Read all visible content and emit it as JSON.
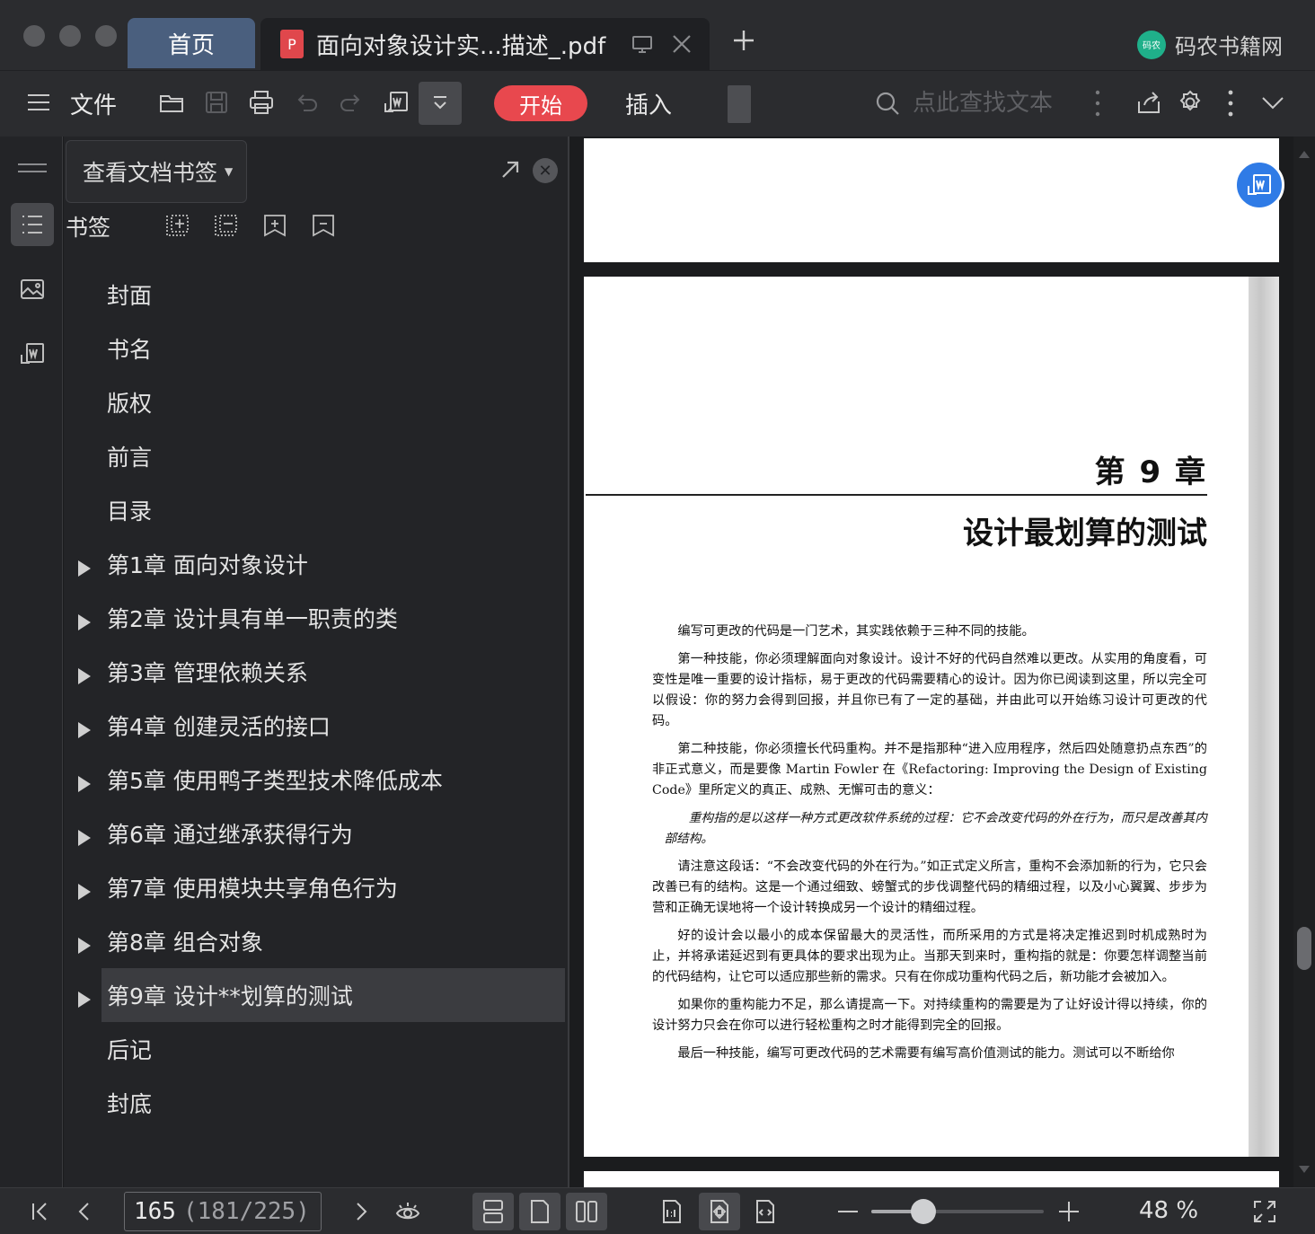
{
  "titlebar": {
    "home_tab": "首页",
    "doc_tab_title": "面向对象设计实...描述_.pdf",
    "pdf_badge": "P",
    "brand": "码农书籍网",
    "brand_logo_text": "码农"
  },
  "toolbar": {
    "file_label": "文件",
    "start_label": "开始",
    "insert_label": "插入",
    "search_placeholder": "点此查找文本"
  },
  "panel": {
    "dropdown_label": "查看文档书签",
    "bookmark_label": "书签",
    "items": [
      {
        "label": "封面",
        "expandable": false
      },
      {
        "label": "书名",
        "expandable": false
      },
      {
        "label": "版权",
        "expandable": false
      },
      {
        "label": "前言",
        "expandable": false
      },
      {
        "label": "目录",
        "expandable": false
      },
      {
        "label": "第1章  面向对象设计",
        "expandable": true
      },
      {
        "label": "第2章  设计具有单一职责的类",
        "expandable": true
      },
      {
        "label": "第3章  管理依赖关系",
        "expandable": true
      },
      {
        "label": "第4章  创建灵活的接口",
        "expandable": true
      },
      {
        "label": "第5章  使用鸭子类型技术降低成本",
        "expandable": true
      },
      {
        "label": "第6章  通过继承获得行为",
        "expandable": true
      },
      {
        "label": "第7章  使用模块共享角色行为",
        "expandable": true
      },
      {
        "label": "第8章  组合对象",
        "expandable": true
      },
      {
        "label": "第9章  设计**划算的测试",
        "expandable": true,
        "selected": true
      },
      {
        "label": "后记",
        "expandable": false
      },
      {
        "label": "封底",
        "expandable": false
      }
    ]
  },
  "document": {
    "chapter_number": "第 9 章",
    "chapter_title": "设计最划算的测试",
    "paragraphs": [
      "编写可更改的代码是一门艺术，其实践依赖于三种不同的技能。",
      "第一种技能，你必须理解面向对象设计。设计不好的代码自然难以更改。从实用的角度看，可变性是唯一重要的设计指标，易于更改的代码需要精心的设计。因为你已阅读到这里，所以完全可以假设：你的努力会得到回报，并且你已有了一定的基础，并由此可以开始练习设计可更改的代码。",
      "第二种技能，你必须擅长代码重构。并不是指那种“进入应用程序，然后四处随意扔点东西”的非正式意义，而是要像 Martin Fowler 在《Refactoring: Improving the Design of Existing Code》里所定义的真正、成熟、无懈可击的意义：",
      "重构指的是以这样一种方式更改软件系统的过程：它不会改变代码的外在行为，而只是改善其内部结构。",
      "请注意这段话：“不会改变代码的外在行为。”如正式定义所言，重构不会添加新的行为，它只会改善已有的结构。这是一个通过细致、螃蟹式的步伐调整代码的精细过程，以及小心翼翼、步步为营和正确无误地将一个设计转换成另一个设计的精细过程。",
      "好的设计会以最小的成本保留最大的灵活性，而所采用的方式是将决定推迟到时机成熟时为止，并将承诺延迟到有更具体的要求出现为止。当那天到来时，重构指的就是：你要怎样调整当前的代码结构，让它可以适应那些新的需求。只有在你成功重构代码之后，新功能才会被加入。",
      "如果你的重构能力不足，那么请提高一下。对持续重构的需要是为了让好设计得以持续，你的设计努力只会在你可以进行轻松重构之时才能得到完全的回报。",
      "最后一种技能，编写可更改代码的艺术需要有编写高价值测试的能力。测试可以不断给你"
    ]
  },
  "statusbar": {
    "page_current": "165",
    "page_total": "(181/225)",
    "zoom_text": "48 %",
    "zoom_fraction": 0.3
  },
  "colors": {
    "accent_red": "#e8484e",
    "float_blue": "#2f7be6",
    "brand_green": "#1fb08a"
  }
}
